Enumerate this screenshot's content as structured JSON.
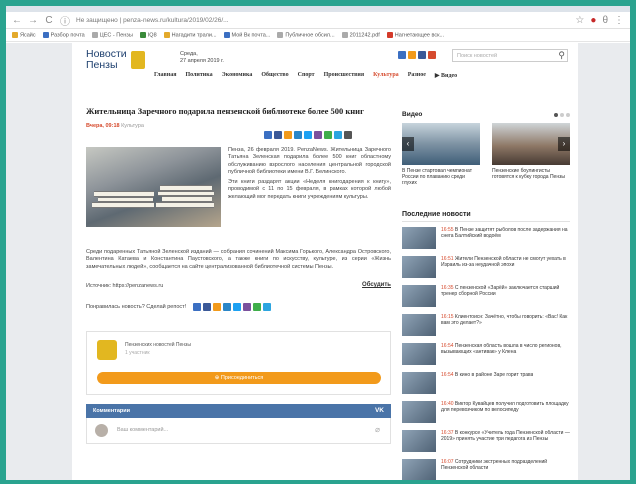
{
  "browser": {
    "url": "Не защищено | penza-news.ru/kultura/2019/02/26/...",
    "bookmarks": [
      "Ясайс",
      "Разбор почта",
      "ЦЕС - Пензы",
      "IQ8",
      "Нагадити трали...",
      "Мой Вк почта...",
      "Публичное обсил...",
      "2011242.pdf",
      "Нагнетающее вск..."
    ]
  },
  "site": {
    "logo": {
      "line1": "Новости",
      "line2": "Пензы"
    },
    "header_date": {
      "line1": "Среда,",
      "line2": "27 апреля 2019 г."
    },
    "search_placeholder": "Поиск новостей",
    "nav": [
      "Главная",
      "Политика",
      "Экономика",
      "Общество",
      "Спорт",
      "Происшествия",
      "Культура",
      "Разное",
      "Видео"
    ],
    "nav_active": "Культура"
  },
  "article": {
    "title": "Жительница Заречного подарила пензенской библиотеке более 500 книг",
    "date": "Вчера, 09:18",
    "category": "Культура",
    "lead_paragraphs": [
      "Пенза, 26 февраля 2019. PenzaNews. Жительница Заречного Татьяна Зеленская подарила более 500 книг областному обслуживанию взрослого населения центральной городской публичной библиотеки имени В.Г. Белинского.",
      "Эти книги раздарят акции «Неделя книгодарения к книгу», проводимой с 11 по 15 февраля, в рамках которой любой желающий мог передать книги учреждениям культуры."
    ],
    "body": "Среди подаренных Татьяной Зеленской изданий — собрания сочинений Максима Горького, Александра Островского, Валентина Катаева и Константина Паустовского, а также книги по искусству, культуре, из серии «Жизнь замечательных людей», сообщается на сайте централизованной библиотечной системы Пензы.",
    "source": "Источник: https://penzanews.ru",
    "discuss": "Обсудить",
    "liked": "Понравилась новость? Сделай репост!",
    "author": {
      "name": "Пензенских новостей Пензы",
      "subscribers": "1 участник"
    },
    "subscribe": "Присоединиться",
    "comments_label": "Комментарии",
    "vk": "VK",
    "comment_placeholder": "Ваш комментарий..."
  },
  "sidebar": {
    "video_head": "Видео",
    "videos": [
      "В Пензе стартовал чемпионат России по плаванию среди глухих",
      "Пензенские боулингисты готовятся к кубку города Пензы"
    ],
    "news_head": "Последние новости",
    "news": [
      {
        "time": "16:55",
        "text": "В Пензе защитят рыболов после задержания на снега Балтийский водоём"
      },
      {
        "time": "16:51",
        "text": "Жители Пензенской области не смогут уехать в Израиль из-за неудачной эпохи"
      },
      {
        "time": "16:35",
        "text": "С пензенской «Зарёй» заключается старший тренер сборной России"
      },
      {
        "time": "16:15",
        "text": "Клиентоисн: Зачётно, чтобы говорить: «Вас! Как вам это делает?»"
      },
      {
        "time": "16:54",
        "text": "Пензенская область вошла в число регионов, вызывающих «антивак» у Клена"
      },
      {
        "time": "16:54",
        "text": "В кино в районе Заре горит трава"
      },
      {
        "time": "16:40",
        "text": "Виктор Кувайцев получил подготовить площадку для перевозчиком по велосипеду"
      },
      {
        "time": "16:37",
        "text": "В конкурсе «Учитель года Пензенской области — 2019» принять участие три педагога из Пензы"
      },
      {
        "time": "16:07",
        "text": "Сотрудники экстренных подразделений Пензенской области"
      }
    ]
  },
  "colors": {
    "frame": "#2aa38f",
    "accent": "#d64b2e",
    "button": "#f29a1b",
    "vk": "#4a74a8"
  }
}
